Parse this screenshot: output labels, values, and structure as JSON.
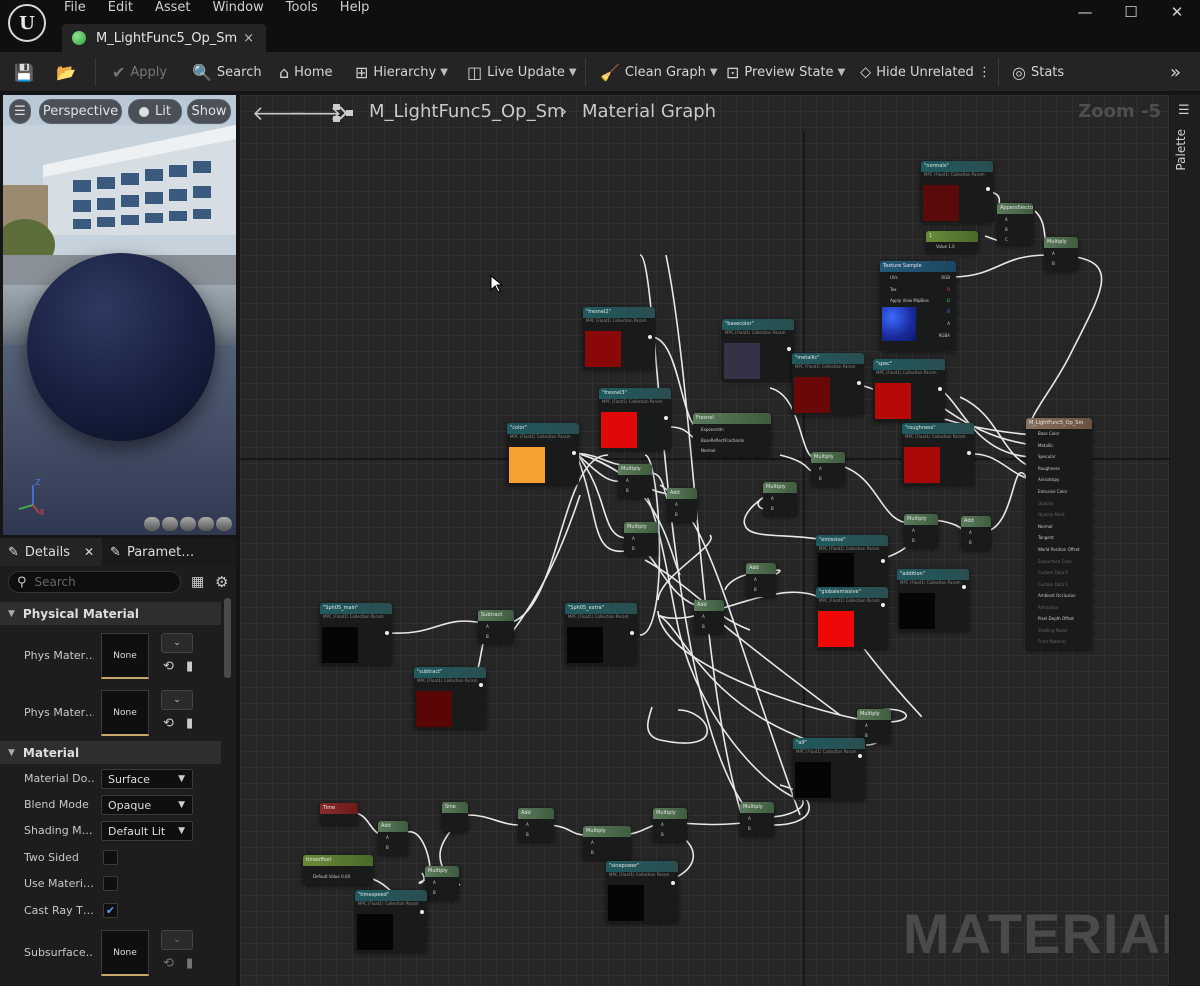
{
  "menu": [
    "File",
    "Edit",
    "Asset",
    "Window",
    "Tools",
    "Help"
  ],
  "tab": {
    "title": "M_LightFunc5_Op_Sm",
    "close": "×"
  },
  "window_controls": {
    "minimize": "—",
    "maximize": "☐",
    "close": "✕"
  },
  "toolbar": {
    "apply": "Apply",
    "search": "Search",
    "home": "Home",
    "hierarchy": "Hierarchy",
    "live_update": "Live Update",
    "clean_graph": "Clean Graph",
    "preview_state": "Preview State",
    "hide_unrelated": "Hide Unrelated",
    "stats": "Stats"
  },
  "viewport": {
    "perspective": "Perspective",
    "lit": "Lit",
    "show": "Show"
  },
  "details": {
    "tab_details": "Details",
    "tab_params": "Paramet…",
    "search_placeholder": "Search",
    "physical_material": {
      "title": "Physical Material",
      "rows": [
        {
          "label": "Phys Mater…",
          "value": "None"
        },
        {
          "label": "Phys Mater…",
          "value": "None"
        }
      ]
    },
    "material": {
      "title": "Material",
      "material_domain": {
        "label": "Material Do…",
        "value": "Surface"
      },
      "blend_mode": {
        "label": "Blend Mode",
        "value": "Opaque"
      },
      "shading_model": {
        "label": "Shading M…",
        "value": "Default Lit"
      },
      "two_sided": {
        "label": "Two Sided",
        "checked": false
      },
      "use_material": {
        "label": "Use Materi…",
        "checked": false
      },
      "cast_ray": {
        "label": "Cast Ray T…",
        "checked": true
      },
      "subsurface": {
        "label": "Subsurface…",
        "value": "None"
      }
    }
  },
  "graph": {
    "breadcrumb_asset": "M_LightFunc5_Op_Sm",
    "breadcrumb_graph": "Material Graph",
    "zoom": "Zoom -5",
    "watermark": "MATERIAL",
    "nodes": {
      "normals": "\"normals\"",
      "append": "AppendVector",
      "constant": "1",
      "multiply": "Multiply",
      "texture_sample": "Texture Sample",
      "fresnel2": "\"fresnel2\"",
      "basecolor": "\"basecolor\"",
      "metallic": "\"metallic\"",
      "spec": "\"spec\"",
      "fresnel3": "\"fresnel3\"",
      "fresnel": "Fresnel",
      "roughness": "\"roughness\"",
      "color": "\"color\"",
      "add": "Add",
      "emissive": "\"emissive\"",
      "addition": "\"addition\"",
      "globalemissive": "\"globalemissive\"",
      "sph_main": "\"Sph05_main\"",
      "subtract": "Subtract",
      "sph_extra": "\"Sph05_extra\"",
      "subtract2": "\"subtract\"",
      "alf": "\"alf\"",
      "time": "Time",
      "timeoffset": "timeoffset",
      "sine": "Sine",
      "timespeed": "\"timespeed\"",
      "sinepower": "\"sinepower\"",
      "result": "M_LightFunc5_Op_Sm"
    },
    "subtitle": "MPC (Float1) Collection Param",
    "texture_pins": [
      "UVs",
      "Tex",
      "Apply View MipBias",
      "RGB",
      "R",
      "G",
      "B",
      "A",
      "RGBA"
    ],
    "fresnel_pins": [
      "ExponentIn",
      "BaseReflectFractionIn",
      "Normal"
    ],
    "result_pins": [
      "Base Color",
      "Metallic",
      "Specular",
      "Roughness",
      "Anisotropy",
      "Emissive Color",
      "Opacity",
      "Opacity Mask",
      "Normal",
      "Tangent",
      "World Position Offset",
      "Subsurface Color",
      "Custom Data 0",
      "Custom Data 1",
      "Ambient Occlusion",
      "Refraction",
      "Pixel Depth Offset",
      "Shading Model",
      "Front Material"
    ]
  },
  "palette": {
    "label": "Palette"
  },
  "colors": {
    "accent_blue": "#3a8ef6",
    "header_teal": "#1e5a5e"
  }
}
